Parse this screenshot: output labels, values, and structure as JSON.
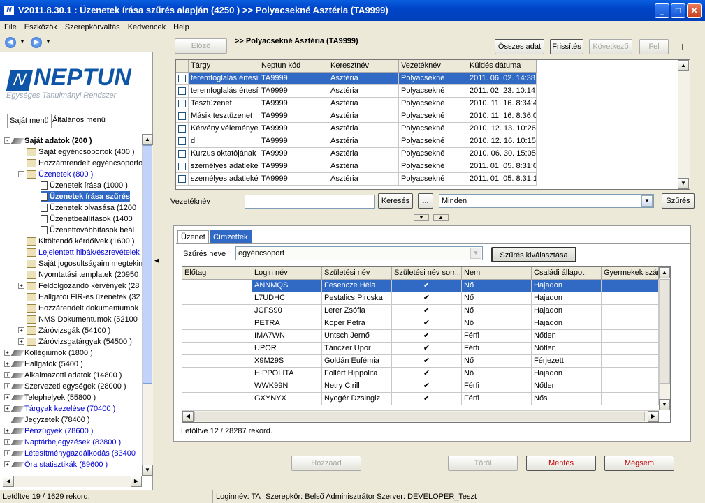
{
  "window": {
    "title": "V2011.8.30.1 : Üzenetek írása szűrés alapján (4250  )  >> Polyacsekné Asztéria (TA9999)",
    "app_icon": "N"
  },
  "menu": [
    "File",
    "Eszközök",
    "Szerepkörváltás",
    "Kedvencek",
    "Help"
  ],
  "logo": {
    "text": "NEPTUN",
    "subtitle": "Egységes Tanulmányi Rendszer"
  },
  "left_tabs": [
    "Saját menü",
    "Általános menü"
  ],
  "tree": [
    {
      "label": "Saját adatok (200  )",
      "level": 0,
      "icon": "book",
      "bold": true,
      "exp": "-"
    },
    {
      "label": "Saját egyéncsoportok (400  )",
      "level": 1,
      "icon": "fold"
    },
    {
      "label": "Hozzámrendelt egyéncsoportok",
      "level": 1,
      "icon": "fold"
    },
    {
      "label": "Üzenetek (800  )",
      "level": 1,
      "icon": "fold",
      "blue": true,
      "exp": "-"
    },
    {
      "label": "Üzenetek írása (1000  )",
      "level": 2,
      "icon": "doc"
    },
    {
      "label": "Üzenetek írása szűrés",
      "level": 2,
      "icon": "doc",
      "selected": true
    },
    {
      "label": "Üzenetek olvasása (1200",
      "level": 2,
      "icon": "doc"
    },
    {
      "label": "Üzenetbeállítások (1400",
      "level": 2,
      "icon": "doc"
    },
    {
      "label": "Üzenettovábbítások beál",
      "level": 2,
      "icon": "doc"
    },
    {
      "label": "Kitöltendő kérdőívek (1600  )",
      "level": 1,
      "icon": "fold"
    },
    {
      "label": "Lejelentett hibák/észrevételek",
      "level": 1,
      "icon": "fold",
      "blue": true
    },
    {
      "label": "Saját jogosultságaim megtekin",
      "level": 1,
      "icon": "fold"
    },
    {
      "label": "Nyomtatási templatek (20950",
      "level": 1,
      "icon": "fold"
    },
    {
      "label": "Feldolgozandó kérvények (28",
      "level": 1,
      "icon": "fold",
      "exp": "+"
    },
    {
      "label": "Hallgatói FIR-es üzenetek (32",
      "level": 1,
      "icon": "fold"
    },
    {
      "label": "Hozzárendelt dokumentumok",
      "level": 1,
      "icon": "fold"
    },
    {
      "label": "NMS Dokumentumok (52100",
      "level": 1,
      "icon": "fold"
    },
    {
      "label": "Záróvizsgák (54100  )",
      "level": 1,
      "icon": "fold",
      "exp": "+"
    },
    {
      "label": "Záróvizsgatárgyak (54500  )",
      "level": 1,
      "icon": "fold",
      "exp": "+"
    },
    {
      "label": "Kollégiumok (1800  )",
      "level": 0,
      "icon": "book",
      "exp": "+"
    },
    {
      "label": "Hallgatók (5400  )",
      "level": 0,
      "icon": "book",
      "exp": "+"
    },
    {
      "label": "Alkalmazotti adatok (14800  )",
      "level": 0,
      "icon": "book",
      "exp": "+"
    },
    {
      "label": "Szervezeti egységek (28000  )",
      "level": 0,
      "icon": "book",
      "exp": "+"
    },
    {
      "label": "Telephelyek (55800  )",
      "level": 0,
      "icon": "book",
      "exp": "+"
    },
    {
      "label": "Tárgyak kezelése (70400  )",
      "level": 0,
      "icon": "book",
      "blue": true,
      "exp": "+"
    },
    {
      "label": "Jegyzetek (78400  )",
      "level": 0,
      "icon": "book"
    },
    {
      "label": "Pénzügyek (78600  )",
      "level": 0,
      "icon": "book",
      "blue": true,
      "exp": "+"
    },
    {
      "label": "Naptárbejegyzések (82800  )",
      "level": 0,
      "icon": "book",
      "blue": true,
      "exp": "+"
    },
    {
      "label": "Létesítménygazdálkodás (83400",
      "level": 0,
      "icon": "book",
      "blue": true,
      "exp": "+"
    },
    {
      "label": "Óra statisztikák (89600  )",
      "level": 0,
      "icon": "book",
      "blue": true,
      "exp": "+"
    }
  ],
  "top": {
    "prev": "Előző",
    "title": ">> Polyacsekné Asztéria (TA9999)",
    "all_data": "Összes adat",
    "refresh": "Frissítés",
    "next": "Következő",
    "up": "Fel",
    "pin": "⊣"
  },
  "msg_grid": {
    "headers": [
      "Tárgy",
      "Neptun kód",
      "Keresztnév",
      "Vezetéknév",
      "Küldés dátuma"
    ],
    "rows": [
      [
        "teremfoglalás értesítő",
        "TA9999",
        "Asztéria",
        "Polyacsekné",
        "2011. 06. 02. 14:38:"
      ],
      [
        "teremfoglalás értesítő",
        "TA9999",
        "Asztéria",
        "Polyacsekné",
        "2011. 02. 23. 10:14:"
      ],
      [
        "Tesztüzenet",
        "TA9999",
        "Asztéria",
        "Polyacsekné",
        "2010. 11. 16. 8:34:4"
      ],
      [
        "Másik tesztüzenet",
        "TA9999",
        "Asztéria",
        "Polyacsekné",
        "2010. 11. 16. 8:36:0"
      ],
      [
        "Kérvény véleményezé",
        "TA9999",
        "Asztéria",
        "Polyacsekné",
        "2010. 12. 13. 10:26:"
      ],
      [
        "d",
        "TA9999",
        "Asztéria",
        "Polyacsekné",
        "2010. 12. 16. 10:15:"
      ],
      [
        "Kurzus oktatójának m",
        "TA9999",
        "Asztéria",
        "Polyacsekné",
        "2010. 06. 30. 15:05:"
      ],
      [
        "személyes adatlekérd",
        "TA9999",
        "Asztéria",
        "Polyacsekné",
        "2011. 01. 05. 8:31:0"
      ],
      [
        "személyes adatlekérd",
        "TA9999",
        "Asztéria",
        "Polyacsekné",
        "2011. 01. 05. 8:31:1"
      ]
    ]
  },
  "search": {
    "label": "Vezetéknév",
    "value": "",
    "button": "Keresés",
    "dots": "...",
    "filter_value": "Minden",
    "filter_button": "Szűrés"
  },
  "bottom": {
    "tabs": [
      "Üzenet",
      "Címzettek"
    ],
    "filter_label": "Szűrés neve",
    "filter_value": "egyéncsoport",
    "filter_choose": "Szűrés kiválasztása",
    "headers": [
      "Előtag",
      "Login név",
      "Születési név",
      "Születési név sorr...",
      "Nem",
      "Családi állapot",
      "Gyermekek szám"
    ],
    "rows": [
      [
        "",
        "ANNMQS",
        "Fesencze Héla",
        "✔",
        "Nő",
        "Hajadon",
        ""
      ],
      [
        "",
        "L7UDHC",
        "Pestalics Piroska",
        "✔",
        "Nő",
        "Hajadon",
        ""
      ],
      [
        "",
        "JCFS90",
        "Lerer Zsófia",
        "✔",
        "Nő",
        "Hajadon",
        ""
      ],
      [
        "",
        "PETRA",
        "Koper Petra",
        "✔",
        "Nő",
        "Hajadon",
        ""
      ],
      [
        "",
        "IMA7WN",
        "Untsch Jernő",
        "✔",
        "Férfi",
        "Nőtlen",
        ""
      ],
      [
        "",
        "UPOR",
        "Tánczer Upor",
        "✔",
        "Férfi",
        "Nőtlen",
        ""
      ],
      [
        "",
        "X9M29S",
        "Goldán Eufémia",
        "✔",
        "Nő",
        "Férjezett",
        ""
      ],
      [
        "",
        "HIPPOLITA",
        "Follért Hippolita",
        "✔",
        "Nő",
        "Hajadon",
        ""
      ],
      [
        "",
        "WWK99N",
        "Netry Cirill",
        "✔",
        "Férfi",
        "Nőtlen",
        ""
      ],
      [
        "",
        "GXYNYX",
        "Nyogér Dzsingiz",
        "✔",
        "Férfi",
        "Nős",
        ""
      ]
    ],
    "loaded": "Letöltve 12 / 28287 rekord."
  },
  "actions": {
    "add": "Hozzáad",
    "delete": "Töröl",
    "save": "Mentés",
    "cancel": "Mégsem"
  },
  "status": {
    "loaded": "Letöltve 19 / 1629 rekord.",
    "login": "Loginnév: TA",
    "role": "Szerepkör: Belső Adminisztrátor",
    "server": "Szerver: DEVELOPER_Teszt"
  },
  "colors": {
    "title_bar": "#0044c8",
    "selection": "#316ac5",
    "danger_text": "#c00000"
  }
}
